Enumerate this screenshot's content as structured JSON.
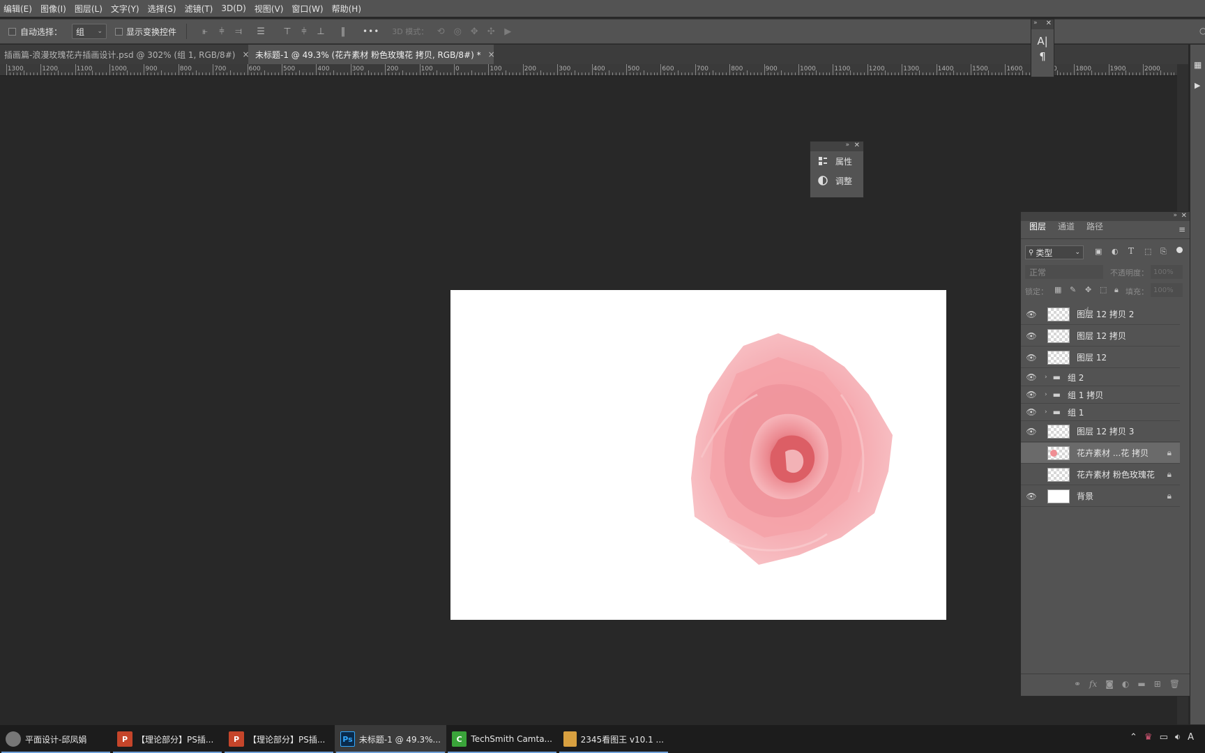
{
  "menu": [
    "编辑(E)",
    "图像(I)",
    "图层(L)",
    "文字(Y)",
    "选择(S)",
    "滤镜(T)",
    "3D(D)",
    "视图(V)",
    "窗口(W)",
    "帮助(H)"
  ],
  "options": {
    "auto_select_label": "自动选择：",
    "auto_select_value": "组",
    "show_transform_label": "显示变换控件",
    "more": "•••",
    "mode_3d_label": "3D 模式："
  },
  "tabs": [
    {
      "label": "插画篇-浪漫玫瑰花卉插画设计.psd @ 302% (组 1, RGB/8#)",
      "close": "×"
    },
    {
      "label": "未标题-1 @ 49.3% (花卉素材 粉色玫瑰花 拷贝, RGB/8#) *",
      "close": "×"
    }
  ],
  "ruler_labels": [
    "1300",
    "1200",
    "1100",
    "1000",
    "900",
    "800",
    "700",
    "600",
    "500",
    "400",
    "300",
    "200",
    "100",
    "0",
    "100",
    "200",
    "300",
    "400",
    "500",
    "600",
    "700",
    "800",
    "900",
    "1000",
    "1100",
    "1200",
    "1300",
    "1400",
    "1500",
    "1600",
    "1700",
    "1800",
    "1900",
    "2000"
  ],
  "props_panel": {
    "properties": "属性",
    "adjustments": "调整"
  },
  "char_panel": {
    "char_icon": "A|",
    "para_icon": "¶"
  },
  "layers_panel": {
    "tabs": [
      "图层",
      "通道",
      "路径"
    ],
    "filter_kind": "类型",
    "blend_mode": "正常",
    "opacity_label": "不透明度：",
    "opacity_value": "100%",
    "lock_label": "锁定：",
    "fill_label": "填充：",
    "fill_value": "100%",
    "layers": [
      {
        "name": "图层 12 拷贝 2",
        "type": "layer",
        "visible": true
      },
      {
        "name": "图层 12 拷贝",
        "type": "layer",
        "visible": true
      },
      {
        "name": "图层 12",
        "type": "layer",
        "visible": true
      },
      {
        "name": "组 2",
        "type": "group",
        "visible": true
      },
      {
        "name": "组 1 拷贝",
        "type": "group",
        "visible": true
      },
      {
        "name": "组 1",
        "type": "group",
        "visible": true
      },
      {
        "name": "图层 12 拷贝 3",
        "type": "layer",
        "visible": true
      },
      {
        "name": "花卉素材 ...花 拷贝",
        "type": "smart",
        "visible": false,
        "locked": true,
        "selected": true
      },
      {
        "name": "花卉素材 粉色玫瑰花",
        "type": "smart",
        "visible": false,
        "locked": true
      },
      {
        "name": "背景",
        "type": "background",
        "visible": true,
        "locked": true
      }
    ],
    "footer_icons": [
      "link-icon",
      "fx-icon",
      "mask-icon",
      "adjustment-icon",
      "folder-icon",
      "new-layer-icon",
      "trash-icon"
    ]
  },
  "taskbar": [
    {
      "label": "平面设计-邱凤娟",
      "icon": "avatar",
      "color": "#888888"
    },
    {
      "label": "【理论部分】PS插...",
      "icon": "P",
      "color": "#c5452a"
    },
    {
      "label": "【理论部分】PS插...",
      "icon": "P",
      "color": "#c5452a"
    },
    {
      "label": "未标题-1 @ 49.3%...",
      "icon": "Ps",
      "color": "#0a2a4a",
      "active": true
    },
    {
      "label": "TechSmith Camta...",
      "icon": "C",
      "color": "#3aa43a"
    },
    {
      "label": "2345看图王 v10.1 ...",
      "icon": "img",
      "color": "#d8a040"
    }
  ],
  "tray_text": "A"
}
